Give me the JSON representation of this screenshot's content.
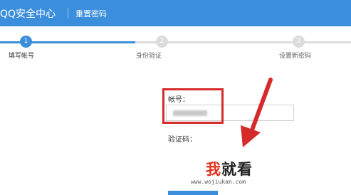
{
  "header": {
    "app_title": "QQ安全中心",
    "page_title": "重置密码"
  },
  "progress": {
    "steps": [
      {
        "number": "1",
        "label": "填写帐号",
        "state": "active"
      },
      {
        "number": "2",
        "label": "身份验证",
        "state": "inactive"
      },
      {
        "number": "3",
        "label": "设置新密码",
        "state": "inactive"
      }
    ]
  },
  "form": {
    "account_label": "帐号：",
    "captcha_label": "验证码："
  },
  "colors": {
    "brand_blue": "#3b8edc",
    "annotation_red": "#d62b2b"
  },
  "watermark": {
    "cn_red": "我",
    "cn_black": "就看",
    "url": "www.wojiukan.com"
  }
}
